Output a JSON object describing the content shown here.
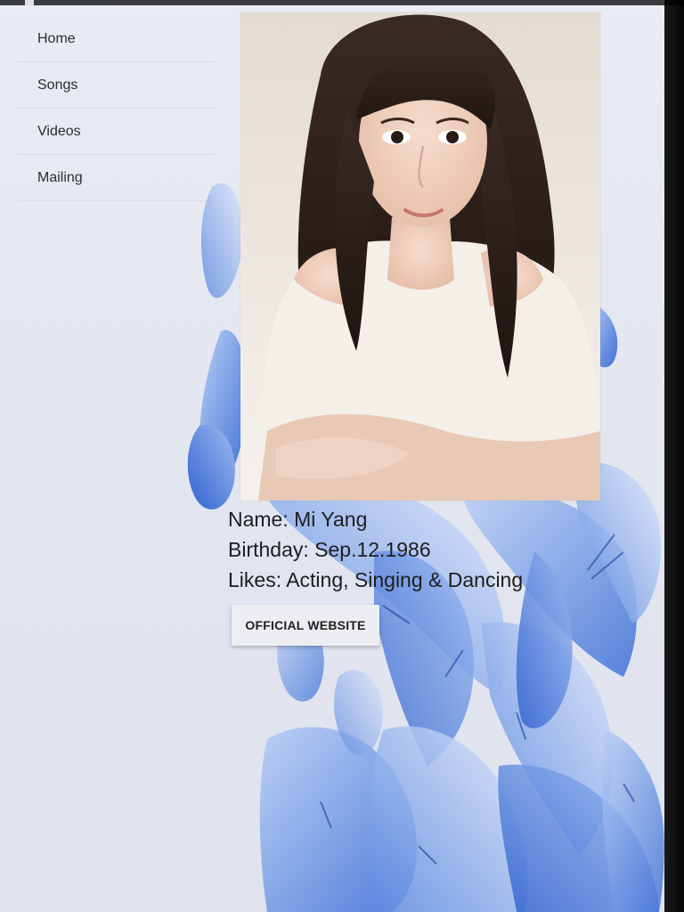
{
  "menu": {
    "items": [
      {
        "label": "Home"
      },
      {
        "label": "Songs"
      },
      {
        "label": "Videos"
      },
      {
        "label": "Mailing"
      }
    ]
  },
  "profile": {
    "photo_icon": "portrait-photo",
    "name_line": "Name: Mi Yang",
    "birthday_line": "Birthday: Sep.12.1986",
    "likes_line": "Likes: Acting, Singing & Dancing"
  },
  "actions": {
    "website_label": "OFFICIAL WEBSITE"
  },
  "colors": {
    "flower_blue": "#3f74d8",
    "flower_light": "#a9c2f3",
    "background": "#e6e9f0"
  }
}
